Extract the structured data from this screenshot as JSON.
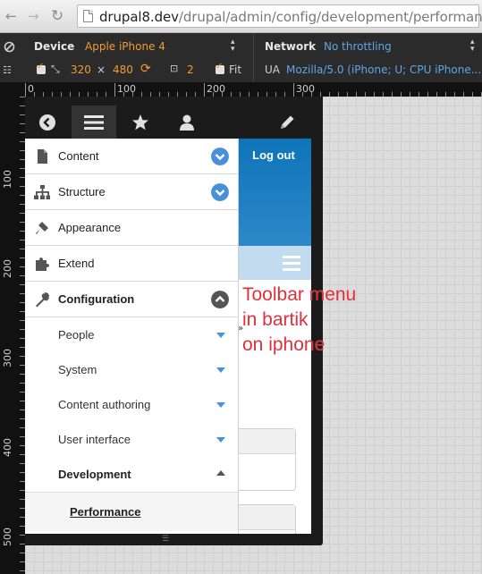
{
  "browser": {
    "url_host": "drupal8.dev",
    "url_path": "/drupal/admin/config/development/performance"
  },
  "devtools": {
    "device_label": "Device",
    "device_value": "Apple iPhone 4",
    "width": "320",
    "times": "×",
    "height": "480",
    "scale": "2",
    "fit_label": "Fit",
    "network_label": "Network",
    "network_value": "No throttling",
    "ua_label": "UA",
    "ua_value": "Mozilla/5.0 (iPhone; U; CPU iPhone..."
  },
  "ruler": {
    "top_ticks": [
      "0",
      "100",
      "200",
      "300"
    ],
    "left_ticks": [
      "100",
      "200",
      "300",
      "400",
      "500"
    ]
  },
  "toolbar": {
    "items": [
      "back",
      "menu",
      "shortcuts",
      "user",
      "edit"
    ]
  },
  "page": {
    "logout": "Log out",
    "raquo": "»"
  },
  "tray": {
    "items": [
      {
        "label": "Content",
        "icon": "file-icon",
        "expandable": true,
        "expanded": false
      },
      {
        "label": "Structure",
        "icon": "sitemap-icon",
        "expandable": true,
        "expanded": false
      },
      {
        "label": "Appearance",
        "icon": "brush-icon",
        "expandable": false
      },
      {
        "label": "Extend",
        "icon": "puzzle-icon",
        "expandable": false
      },
      {
        "label": "Configuration",
        "icon": "wrench-icon",
        "expandable": true,
        "expanded": true
      }
    ],
    "subitems": [
      {
        "label": "People",
        "expanded": false
      },
      {
        "label": "System",
        "expanded": false
      },
      {
        "label": "Content authoring",
        "expanded": false
      },
      {
        "label": "User interface",
        "expanded": false
      },
      {
        "label": "Development",
        "expanded": true
      }
    ],
    "active": "Performance"
  },
  "annotation": "Toolbar menu\nin bartik\non iphone",
  "colors": {
    "toggle_blue": "#4a90d9",
    "annotation_red": "#e0303a",
    "devtools_orange": "#f29a38",
    "devtools_blue": "#5ea6e8"
  }
}
